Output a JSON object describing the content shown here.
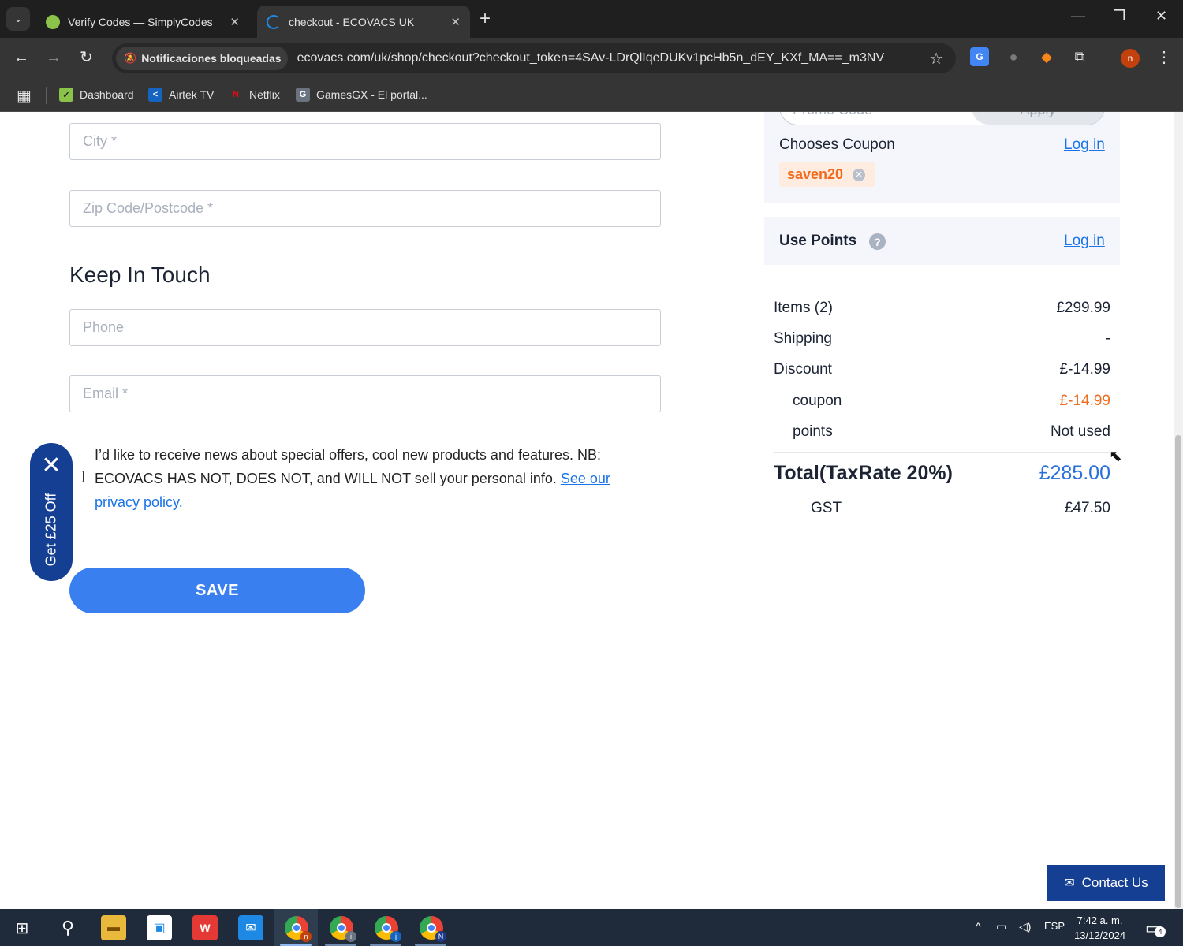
{
  "browser": {
    "tabs": [
      {
        "title": "Verify Codes — SimplyCodes"
      },
      {
        "title": "checkout - ECOVACS UK"
      }
    ],
    "notification_chip": "Notificaciones bloqueadas",
    "url": "ecovacs.com/uk/shop/checkout?checkout_token=4SAv-LDrQlIqeDUKv1pcHb5n_dEY_KXf_MA==_m3NV",
    "profile_initial": "n",
    "bookmarks": [
      {
        "label": "Dashboard",
        "icon": "✓"
      },
      {
        "label": "Airtek TV",
        "icon": "<"
      },
      {
        "label": "Netflix",
        "icon": "N"
      },
      {
        "label": "GamesGX - El portal...",
        "icon": "G"
      }
    ]
  },
  "form": {
    "city_placeholder": "City *",
    "zip_placeholder": "Zip Code/Postcode *",
    "section_title": "Keep In Touch",
    "phone_placeholder": "Phone",
    "email_placeholder": "Email *",
    "consent_text": "I’d like to receive news about special offers, cool new products and features. NB: ECOVACS HAS NOT, DOES NOT, and WILL NOT sell your personal info. ",
    "consent_link": "See our privacy policy.",
    "save_label": "SAVE"
  },
  "promo_tab": {
    "label": "Get £25 Off",
    "close_glyph": "✕"
  },
  "summary": {
    "promo_code_placeholder": "Promo Code",
    "apply_label": "Apply",
    "choose_coupon_label": "Chooses Coupon",
    "login_label": "Log in",
    "coupon_code": "saven20",
    "use_points_label": "Use Points",
    "help_glyph": "?",
    "rows": [
      {
        "label": "Items (2)",
        "value": "£299.99"
      },
      {
        "label": "Shipping",
        "value": "-"
      },
      {
        "label": "Discount",
        "value": "£-14.99"
      },
      {
        "label": "coupon",
        "value": "£-14.99"
      },
      {
        "label": "points",
        "value": "Not used"
      }
    ],
    "total_label": "Total(TaxRate 20%)",
    "total_value": "£285.00",
    "gst_label": "GST",
    "gst_value": "£47.50"
  },
  "contact": {
    "label": "Contact Us"
  },
  "taskbar": {
    "lang": "ESP",
    "time": "7:42 a. m.",
    "date": "13/12/2024",
    "notification_count": "4",
    "chrome_badges": [
      "n",
      "i",
      "j",
      "N"
    ]
  },
  "colors": {
    "accent_blue": "#3a7ff0",
    "navy": "#153f92",
    "coupon_orange": "#f26b1d",
    "link_blue": "#1a73e8"
  }
}
